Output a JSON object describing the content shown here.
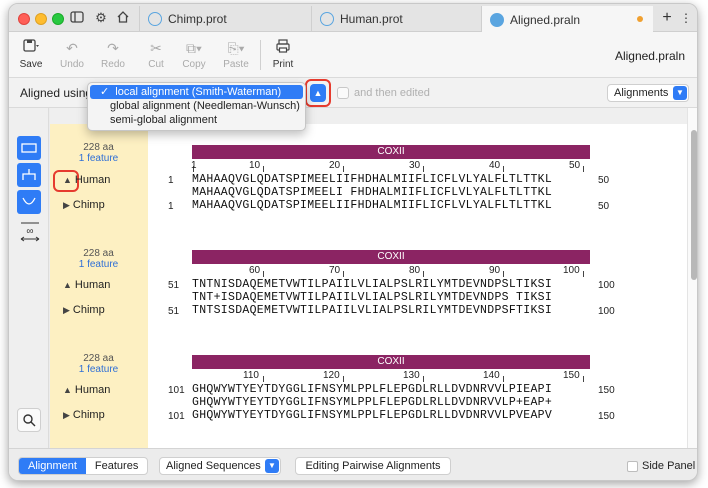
{
  "tabs": [
    {
      "label": "Chimp.prot",
      "active": false
    },
    {
      "label": "Human.prot",
      "active": false
    },
    {
      "label": "Aligned.praln",
      "active": true
    }
  ],
  "toolbar": {
    "save": "Save",
    "undo": "Undo",
    "redo": "Redo",
    "cut": "Cut",
    "copy": "Copy",
    "paste": "Paste",
    "print": "Print",
    "doc_title": "Aligned.praln"
  },
  "options": {
    "aligned_using": "Aligned using",
    "menu": [
      {
        "label": "local alignment  (Smith-Waterman)",
        "selected": true
      },
      {
        "label": "global alignment  (Needleman-Wunsch)",
        "selected": false
      },
      {
        "label": "semi-global alignment",
        "selected": false
      }
    ],
    "check_mark": "✓",
    "and_then_edited": "and then edited",
    "view": "Alignments"
  },
  "blocks": [
    {
      "aa": "228 aa",
      "features": "1 feature",
      "feature_name": "COXII",
      "ticks": [
        "1",
        "10",
        "20",
        "30",
        "40",
        "50"
      ],
      "human": {
        "name": "Human",
        "start": "1",
        "seq": "MAHAAQVGLQDATSPIMEELIIFHDHALMIIFLICFLVLYALFLTLTTKL",
        "end": "50"
      },
      "consensus": "MAHAAQVGLQDATSPIMEELI FHDHALMIIFLICFLVLYALFLTLTTKL",
      "chimp": {
        "name": "Chimp",
        "start": "1",
        "seq": "MAHAAQVGLQDATSPIMEELIIFHDHALMIIFLICFLVLYALFLTLTTKL",
        "end": "50"
      }
    },
    {
      "aa": "228 aa",
      "features": "1 feature",
      "feature_name": "COXII",
      "ticks": [
        "60",
        "70",
        "80",
        "90",
        "100"
      ],
      "human": {
        "name": "Human",
        "start": "51",
        "seq": "TNTNISDAQEMETVWTILPAIILVLIALPSLRILYMTDEVNDPSLTIKSI",
        "end": "100"
      },
      "consensus": "TNT+ISDAQEMETVWTILPAIILVLIALPSLRILYMTDEVNDPS TIKSI",
      "chimp": {
        "name": "Chimp",
        "start": "51",
        "seq": "TNTSISDAQEMETVWTILPAIILVLIALPSLRILYMTDEVNDPSFTIKSI",
        "end": "100"
      }
    },
    {
      "aa": "228 aa",
      "features": "1 feature",
      "feature_name": "COXII",
      "ticks": [
        "110",
        "120",
        "130",
        "140",
        "150"
      ],
      "human": {
        "name": "Human",
        "start": "101",
        "seq": "GHQWYWTYEYTDYGGLIFNSYMLPPLFLEPGDLRLLDVDNRVVLPIEAPI",
        "end": "150"
      },
      "consensus": "GHQWYWTYEYTDYGGLIFNSYMLPPLFLEPGDLRLLDVDNRVVLP+EAP+",
      "chimp": {
        "name": "Chimp",
        "start": "101",
        "seq": "GHQWYWTYEYTDYGGLIFNSYMLPPLFLEPGDLRLLDVDNRVVLPVEAPV",
        "end": "150"
      }
    }
  ],
  "bottom": {
    "tab_alignment": "Alignment",
    "tab_features": "Features",
    "sequences_select": "Aligned Sequences",
    "editing_button": "Editing Pairwise Alignments",
    "side_panel": "Side Panel"
  },
  "colors": {
    "accent": "#2f7cf6",
    "feature": "#8b2463",
    "highlight": "#e63b2e",
    "name_column": "#fdf0c2"
  }
}
